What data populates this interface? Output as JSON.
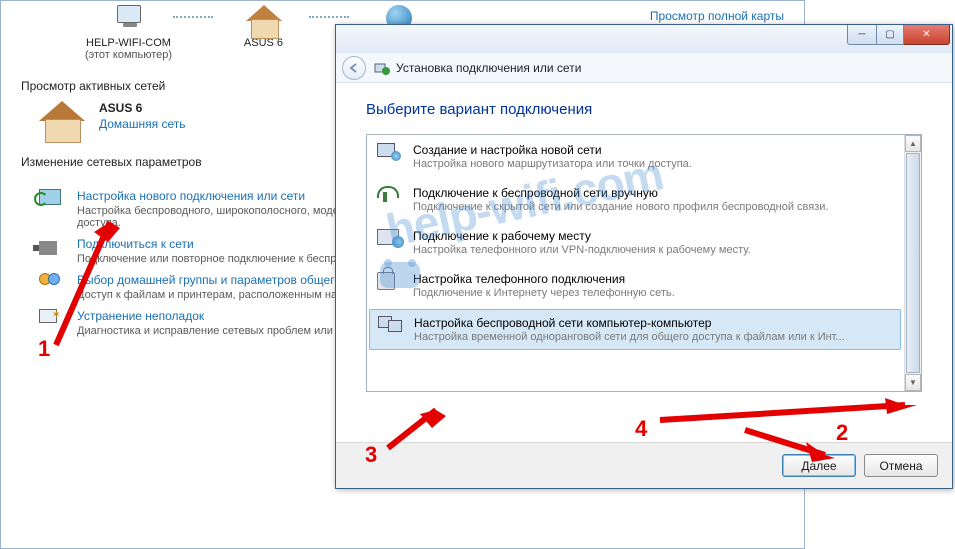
{
  "background": {
    "map": {
      "item1_label": "HELP-WIFI-COM",
      "item1_sub": "(этот компьютер)",
      "item2_label": "ASUS  6",
      "full_map_link": "Просмотр полной карты"
    },
    "active_heading": "Просмотр активных сетей",
    "net": {
      "name": "ASUS  6",
      "type": "Домашняя сеть"
    },
    "change_heading": "Изменение сетевых параметров",
    "opts": [
      {
        "title": "Настройка нового подключения или сети",
        "desc": "Настройка беспроводного, широкополосного, модемного, прямого или VPN-подключения или же настройка маршрутизатора или точки доступа."
      },
      {
        "title": "Подключиться к сети",
        "desc": "Подключение или повторное подключение к беспроводному, проводному, модемному сетевому соединению или подключение к VPN."
      },
      {
        "title": "Выбор домашней группы и параметров общего доступа",
        "desc": "Доступ к файлам и принтерам, расположенным на других сетевых компьютерах, или изменение параметров общего доступа."
      },
      {
        "title": "Устранение неполадок",
        "desc": "Диагностика и исправление сетевых проблем или получение сведений об исправлении."
      }
    ]
  },
  "wizard": {
    "crumb": "Установка подключения или сети",
    "heading": "Выберите вариант подключения",
    "items": [
      {
        "title": "Создание и настройка новой сети",
        "desc": "Настройка нового маршрутизатора или точки доступа."
      },
      {
        "title": "Подключение к беспроводной сети вручную",
        "desc": "Подключение к скрытой сети или создание нового профиля беспроводной связи."
      },
      {
        "title": "Подключение к рабочему месту",
        "desc": "Настройка телефонного или VPN-подключения к рабочему месту."
      },
      {
        "title": "Настройка телефонного подключения",
        "desc": "Подключение к Интернету через телефонную сеть."
      },
      {
        "title": "Настройка беспроводной сети компьютер-компьютер",
        "desc": "Настройка временной одноранговой сети для общего доступа к файлам или к Инт..."
      }
    ],
    "btn_next": "Далее",
    "btn_cancel": "Отмена"
  },
  "watermark": "help-wifi.com",
  "anno": {
    "n1": "1",
    "n2": "2",
    "n3": "3",
    "n4": "4"
  }
}
